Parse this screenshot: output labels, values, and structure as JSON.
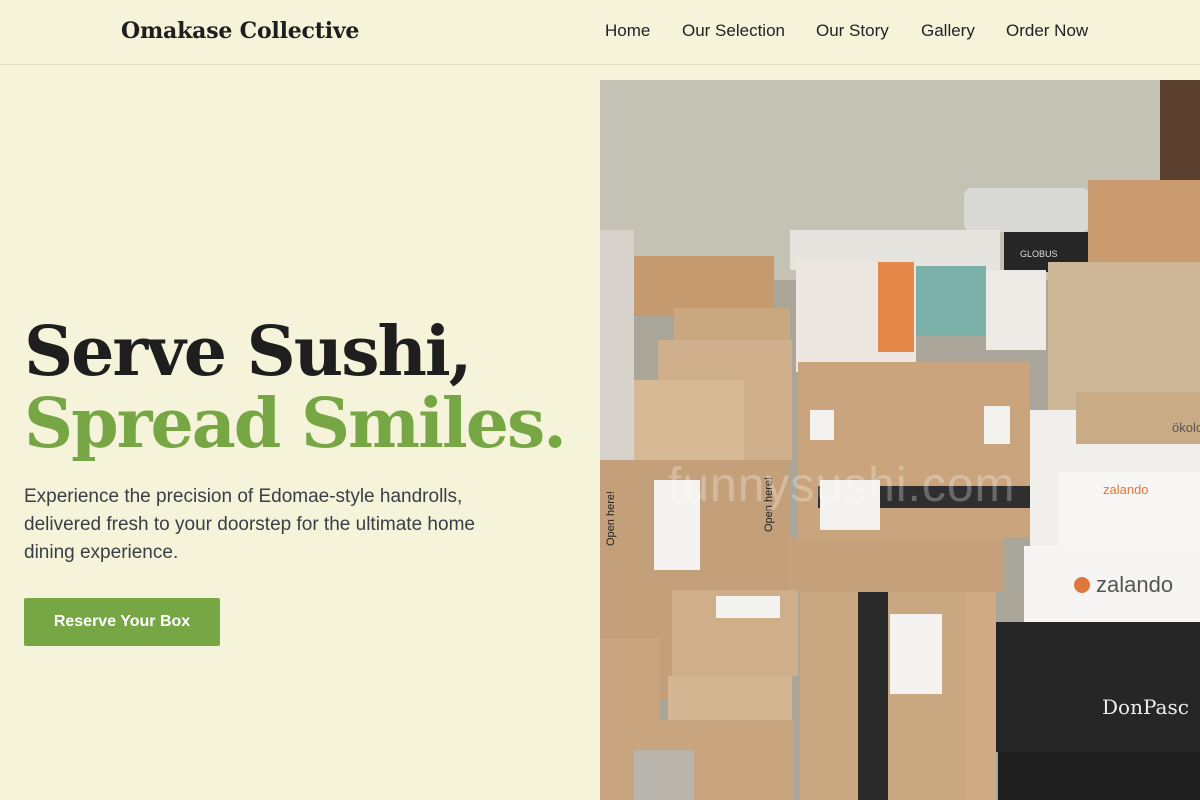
{
  "header": {
    "brand": "Omakase Collective",
    "nav": [
      {
        "label": "Home"
      },
      {
        "label": "Our Selection"
      },
      {
        "label": "Our Story"
      },
      {
        "label": "Gallery"
      },
      {
        "label": "Order Now"
      }
    ]
  },
  "hero": {
    "title_line1": "Serve Sushi,",
    "title_line2": "Spread Smiles.",
    "description": "Experience the precision of Edomae-style handrolls, delivered fresh to your doorstep for the ultimate home dining experience.",
    "cta_label": "Reserve Your Box",
    "image": {
      "alt": "Stacked cardboard delivery boxes",
      "watermark": "funnysushi.com",
      "box_labels": [
        "zalando",
        "zalando",
        "DonPasc",
        "Open here!",
        "Open here!",
        "ökolo",
        "GLOBUS"
      ]
    }
  },
  "colors": {
    "background": "#f5f3da",
    "accent": "#77a644",
    "heading": "#1e1e1e",
    "body_text": "#3a3e45"
  }
}
